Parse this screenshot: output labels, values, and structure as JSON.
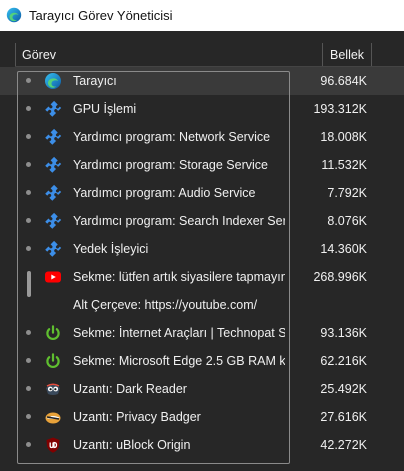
{
  "window": {
    "title": "Tarayıcı Görev Yöneticisi"
  },
  "columns": {
    "task": "Görev",
    "memory": "Bellek"
  },
  "rows": [
    {
      "name": "Tarayıcı",
      "memory": "96.684K",
      "icon": "edge-icon",
      "selected": true
    },
    {
      "name": "GPU İşlemi",
      "memory": "193.312K",
      "icon": "puzzle-icon"
    },
    {
      "name": "Yardımcı program: Network Service",
      "memory": "18.008K",
      "icon": "puzzle-icon"
    },
    {
      "name": "Yardımcı program: Storage Service",
      "memory": "11.532K",
      "icon": "puzzle-icon"
    },
    {
      "name": "Yardımcı program: Audio Service",
      "memory": "7.792K",
      "icon": "puzzle-icon"
    },
    {
      "name": "Yardımcı program: Search Indexer Servi...",
      "memory": "8.076K",
      "icon": "puzzle-icon"
    },
    {
      "name": "Yedek İşleyici",
      "memory": "14.360K",
      "icon": "puzzle-icon"
    },
    {
      "name": "Sekme: lütfen artık siyasilere tapmayın....",
      "memory": "268.996K",
      "icon": "youtube-icon",
      "group_start": true
    },
    {
      "name": "Alt Çerçeve: https://youtube.com/",
      "memory": "",
      "icon": "",
      "group_end": true
    },
    {
      "name": "Sekme: İnternet Araçları | Technopat So...",
      "memory": "93.136K",
      "icon": "power-icon"
    },
    {
      "name": "Sekme: Microsoft Edge 2.5 GB RAM kul...",
      "memory": "62.216K",
      "icon": "power-icon"
    },
    {
      "name": "Uzantı: Dark Reader",
      "memory": "25.492K",
      "icon": "dark-reader-icon"
    },
    {
      "name": "Uzantı: Privacy Badger",
      "memory": "27.616K",
      "icon": "privacy-badger-icon"
    },
    {
      "name": "Uzantı: uBlock Origin",
      "memory": "42.272K",
      "icon": "ublock-origin-icon"
    }
  ]
}
